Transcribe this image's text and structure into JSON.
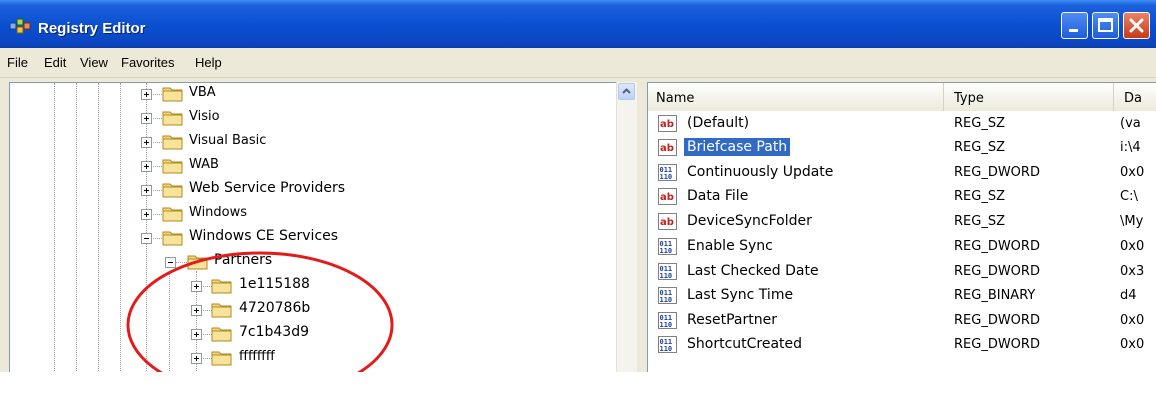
{
  "window": {
    "title": "Registry Editor"
  },
  "menu": [
    "File",
    "Edit",
    "View",
    "Favorites",
    "Help"
  ],
  "tree": {
    "items": [
      {
        "label": "VBA",
        "expander": "+"
      },
      {
        "label": "Visio",
        "expander": "+"
      },
      {
        "label": "Visual Basic",
        "expander": "+"
      },
      {
        "label": "WAB",
        "expander": "+"
      },
      {
        "label": "Web Service Providers",
        "expander": "+"
      },
      {
        "label": "Windows",
        "expander": "+"
      },
      {
        "label": "Windows CE Services",
        "expander": "-"
      },
      {
        "label": "Partners",
        "expander": "-"
      },
      {
        "label": "1e115188",
        "expander": "+"
      },
      {
        "label": "4720786b",
        "expander": "+"
      },
      {
        "label": "7c1b43d9",
        "expander": "+"
      },
      {
        "label": "ffffffff",
        "expander": "+"
      }
    ]
  },
  "list": {
    "columns": [
      "Name",
      "Type",
      "Da"
    ],
    "rows": [
      {
        "name": "(Default)",
        "type": "REG_SZ",
        "data": "(va",
        "icon": "string-value-icon"
      },
      {
        "name": "Briefcase Path",
        "type": "REG_SZ",
        "data": "i:\\4",
        "icon": "string-value-icon",
        "selected": true
      },
      {
        "name": "Continuously Update",
        "type": "REG_DWORD",
        "data": "0x0",
        "icon": "binary-value-icon"
      },
      {
        "name": "Data File",
        "type": "REG_SZ",
        "data": "C:\\",
        "icon": "string-value-icon"
      },
      {
        "name": "DeviceSyncFolder",
        "type": "REG_SZ",
        "data": "\\My",
        "icon": "string-value-icon"
      },
      {
        "name": "Enable Sync",
        "type": "REG_DWORD",
        "data": "0x0",
        "icon": "binary-value-icon"
      },
      {
        "name": "Last Checked Date",
        "type": "REG_DWORD",
        "data": "0x3",
        "icon": "binary-value-icon"
      },
      {
        "name": "Last Sync Time",
        "type": "REG_BINARY",
        "data": "d4",
        "icon": "binary-value-icon"
      },
      {
        "name": "ResetPartner",
        "type": "REG_DWORD",
        "data": "0x0",
        "icon": "binary-value-icon"
      },
      {
        "name": "ShortcutCreated",
        "type": "REG_DWORD",
        "data": "0x0",
        "icon": "binary-value-icon"
      }
    ]
  },
  "annotation": {
    "shape": "ellipse",
    "color": "#e41b1b"
  },
  "colors": {
    "titlebar": "#0a4fd0",
    "selection": "#316ac5",
    "folder": "#f3d77a"
  }
}
